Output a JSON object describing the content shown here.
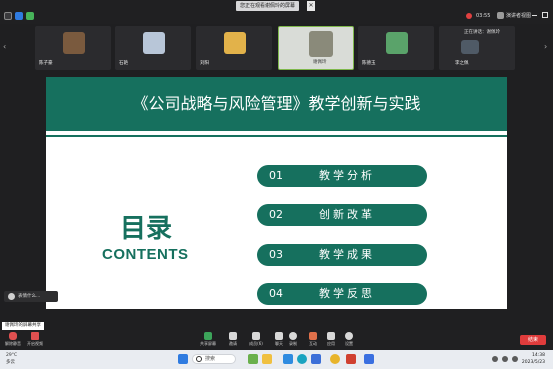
{
  "topbar": {
    "share_banner": "您正在观看谢佩玲的屏幕",
    "close_glyph": "✕",
    "record_time": "03:55",
    "view_label": "演讲者视图"
  },
  "participants": [
    {
      "name": "陈子豪"
    },
    {
      "name": "石艳"
    },
    {
      "name": "刘阳"
    },
    {
      "name": "谢佩玲"
    },
    {
      "name": "陈德玉"
    },
    {
      "name": "李之佩"
    }
  ],
  "speaking_label": "正在讲话：谢佩玲",
  "slide": {
    "title": "《公司战略与风险管理》教学创新与实践",
    "toc_cn": "目录",
    "toc_en": "CONTENTS",
    "items": [
      {
        "num": "01",
        "label": "教学分析"
      },
      {
        "num": "02",
        "label": "创新改革"
      },
      {
        "num": "03",
        "label": "教学成果"
      },
      {
        "num": "04",
        "label": "教学反思"
      }
    ]
  },
  "float_pill": "表情什么...",
  "share_tag": "谢佩玲的屏幕共享",
  "toolbar": {
    "left": [
      {
        "label": "解除静音"
      },
      {
        "label": "开启视频"
      }
    ],
    "buttons": [
      {
        "label": "共享屏幕"
      },
      {
        "label": "邀请"
      },
      {
        "label": "成员(6)"
      },
      {
        "label": "聊天"
      },
      {
        "label": "录制"
      },
      {
        "label": "互动"
      },
      {
        "label": "应用"
      },
      {
        "label": "设置"
      }
    ],
    "end": "结束"
  },
  "taskbar": {
    "temp": "29°C",
    "weather": "多云",
    "search": "搜索",
    "time": "14:38",
    "date": "2023/5/23"
  },
  "colors": {
    "accent": "#16705e"
  }
}
